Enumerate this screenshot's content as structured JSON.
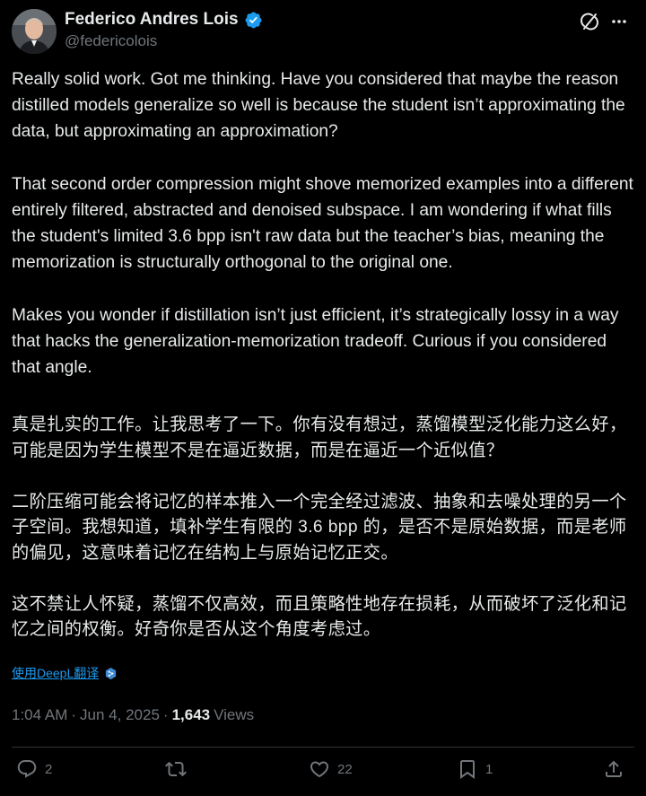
{
  "author": {
    "display_name": "Federico Andres Lois",
    "handle": "@federicolois",
    "verified": true
  },
  "header_icons": [
    "grok-icon",
    "more-icon"
  ],
  "post": {
    "paragraphs": [
      "Really solid work. Got me thinking. Have you considered that maybe the reason distilled models generalize so well is because the student isn’t approximating the data, but approximating an approximation?",
      "That second order compression might shove memorized examples into a different entirely filtered, abstracted and denoised subspace. I am wondering if what fills the student's limited 3.6 bpp isn't raw data but the teacher’s bias, meaning the memorization is structurally orthogonal to the original one.",
      "Makes you wonder if distillation isn’t just efficient, it’s strategically lossy in a way that hacks the generalization-memorization tradeoff. Curious if you considered that angle."
    ],
    "translation": [
      "真是扎实的工作。让我思考了一下。你有没有想过，蒸馏模型泛化能力这么好，可能是因为学生模型不是在逼近数据，而是在逼近一个近似值？",
      "二阶压缩可能会将记忆的样本推入一个完全经过滤波、抽象和去噪处理的另一个子空间。我想知道，填补学生有限的 3.6 bpp 的，是否不是原始数据，而是老师的偏见，这意味着记忆在结构上与原始记忆正交。",
      "这不禁让人怀疑，蒸馏不仅高效，而且策略性地存在损耗，从而破坏了泛化和记忆之间的权衡。好奇你是否从这个角度考虑过。"
    ],
    "translate_label": "使用DeepL翻译"
  },
  "meta": {
    "time": "1:04 AM",
    "separator": "·",
    "date": "Jun 4, 2025",
    "views_count": "1,643",
    "views_label": "Views"
  },
  "actions": {
    "replies": "2",
    "reposts": "",
    "likes": "22",
    "bookmarks": "1"
  },
  "colors": {
    "background": "#000000",
    "text": "#e7e9ea",
    "muted": "#71767b",
    "accent": "#1d9bf0",
    "divider": "#2f3336"
  }
}
